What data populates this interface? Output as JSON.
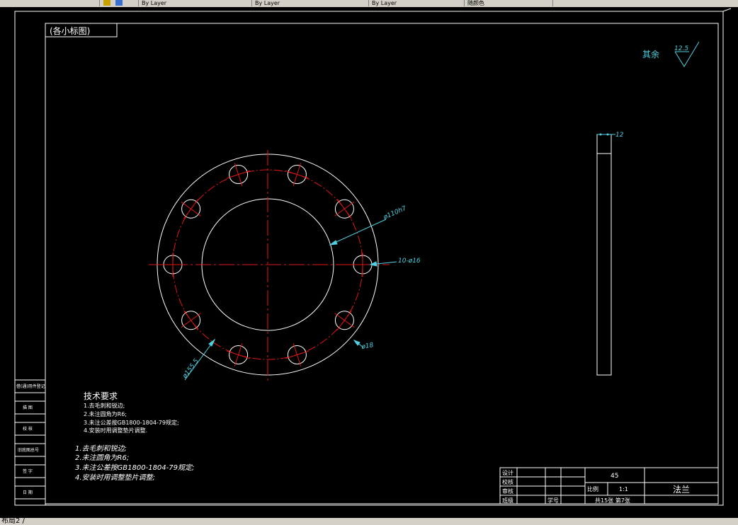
{
  "topbar": {
    "tabs": [
      {
        "label": "By Layer"
      },
      {
        "label": "By Layer"
      },
      {
        "label": "By Layer"
      },
      {
        "label": "随颜色"
      }
    ]
  },
  "drawing": {
    "title_box": "(各小标图)",
    "roughness_prefix": "其余",
    "roughness_value": "12.5",
    "dim_diameter_110": "ø110h7",
    "dim_holes": "10-ø16",
    "dim_pcd": "ø155.5",
    "dim_hole_dia": "ø18",
    "dim_thickness": "12",
    "tech_req_title": "技术要求",
    "tech_req_small": [
      "1.去毛刺和锐边;",
      "2.未注圆角为R6;",
      "3.未注公差按GB1800-1804-79规定;",
      "4.安装时用调整垫片调整."
    ],
    "tech_req_large": [
      "1.去毛刺和锐边;",
      "2.未注圆角为R6;",
      "3.未注公差按GB1800-1804-79规定;",
      "4.安装时用调整垫片调整;"
    ],
    "left_column": [
      "借(通)用件登记",
      "描 图",
      "校 核",
      "旧底图总号",
      "签 字",
      "日 期"
    ],
    "title_block": {
      "design": "设计",
      "check": "校核",
      "review": "审核",
      "class": "班级",
      "student_no": "学号",
      "material": "45",
      "scale_label": "比例",
      "scale": "1:1",
      "sheets": "共15张 第7张",
      "part_name": "法兰"
    }
  },
  "status": {
    "text": "布局2 /"
  }
}
